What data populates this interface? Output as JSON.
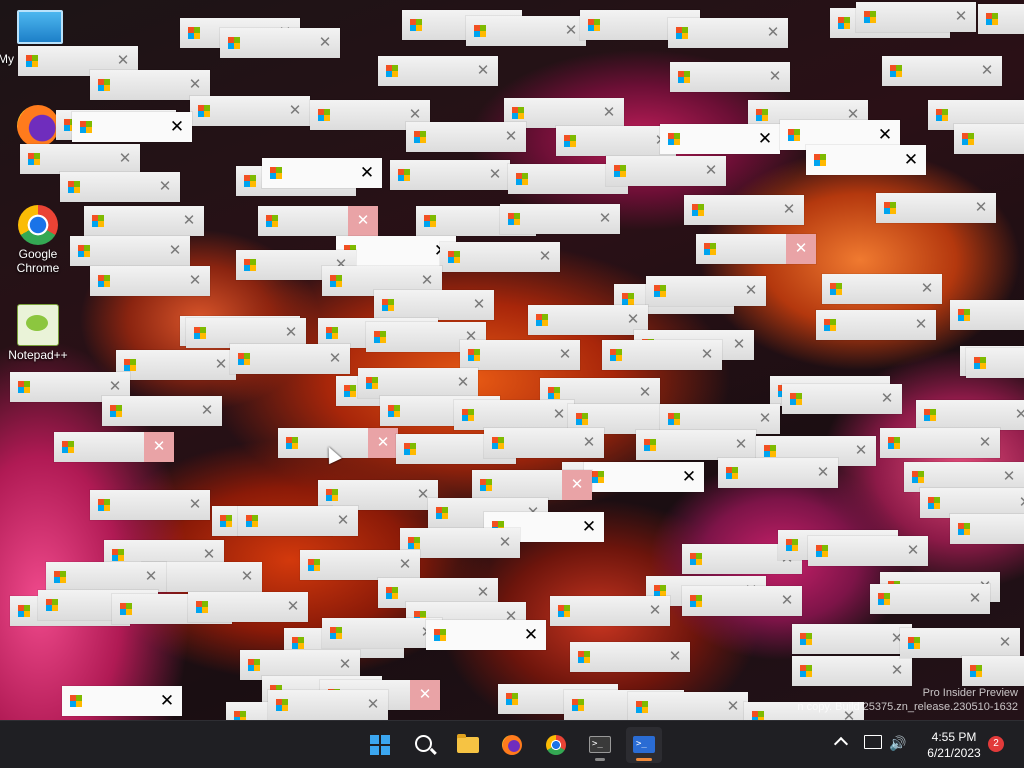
{
  "desktop": {
    "icons": [
      {
        "label": "My",
        "icon": "this-pc-icon"
      },
      {
        "label": "",
        "icon": "firefox-icon"
      },
      {
        "label": "Google Chrome",
        "icon": "chrome-icon"
      },
      {
        "label": "Notepad++",
        "icon": "notepad-plus-plus-icon"
      }
    ],
    "watermark": {
      "line1": "Pro Insider Preview",
      "line2": "n copy. Build 25375.zn_release.230510-1632"
    }
  },
  "message_box": {
    "close_glyph": "✕",
    "app_icon": "generic-app-icon"
  },
  "taskbar": {
    "start": "start-icon",
    "search": "search-icon",
    "apps": [
      "file-explorer-icon",
      "firefox-icon",
      "chrome-icon",
      "terminal-icon",
      "powershell-icon"
    ],
    "tray": {
      "chevron": "show-hidden-icons-chevron-icon",
      "network": "network-icon",
      "volume": "volume-icon",
      "time": "4:55 PM",
      "date": "6/21/2023",
      "notifications": "2"
    }
  },
  "colors": {
    "taskbar": "#1f1f23",
    "close_hover": "#e9a3a6",
    "accent": "#3ba6f0"
  }
}
